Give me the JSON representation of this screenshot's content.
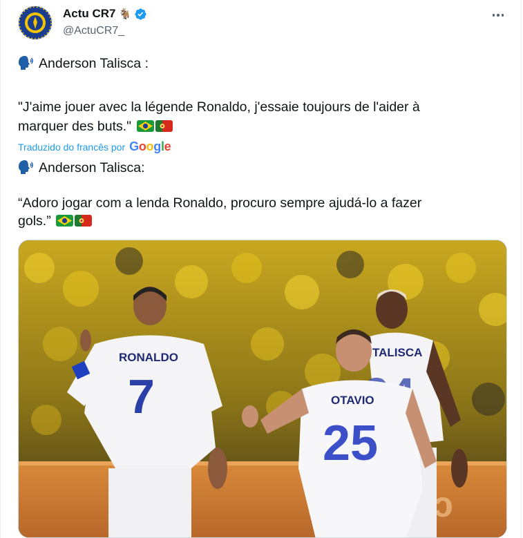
{
  "author": {
    "display_name": "Actu CR7",
    "handle": "@ActuCR7_",
    "goat_emoji": "🐐",
    "avatar_icon": "crest-icon",
    "verified_icon": "verified-badge-icon"
  },
  "tweet": {
    "original": {
      "speaker": "Anderson Talisca :",
      "quote_line1": "\"J'aime jouer avec la légende Ronaldo, j'essaie toujours de l'aider à",
      "quote_line2": "marquer des buts.\""
    },
    "translation_note": "Traduzido do francês por",
    "translation_provider": "Google",
    "translated": {
      "speaker": "Anderson Talisca:",
      "quote_line1": "“Adoro jogar com a lenda Ronaldo, procuro sempre ajudá-lo a fazer",
      "quote_line2": "gols.”"
    },
    "flags": [
      "flag-brazil",
      "flag-portugal"
    ]
  },
  "photo": {
    "jerseys": [
      {
        "name": "RONALDO",
        "number": "7"
      },
      {
        "name": "OTAVIO",
        "number": "25"
      },
      {
        "name": "TALISCA",
        "number": "94"
      }
    ]
  },
  "colors": {
    "link": "#1d9bf0",
    "muted": "#536471",
    "text": "#0f1419",
    "verified": "#1d9bf0"
  }
}
